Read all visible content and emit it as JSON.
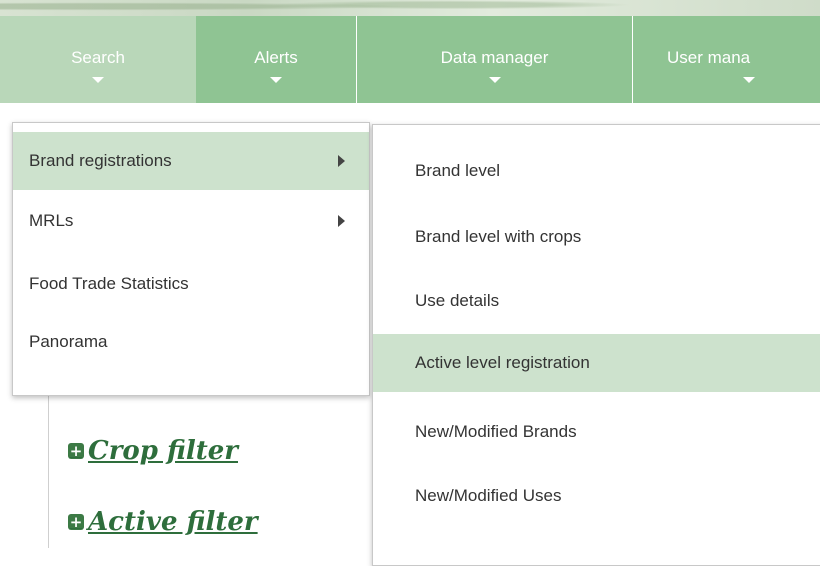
{
  "nav": {
    "items": [
      {
        "label": "Search"
      },
      {
        "label": "Alerts"
      },
      {
        "label": "Data manager"
      },
      {
        "label": "User mana"
      }
    ]
  },
  "search_menu": {
    "items": [
      {
        "label": "Brand registrations",
        "has_submenu": true,
        "highlighted": true
      },
      {
        "label": "MRLs",
        "has_submenu": true
      },
      {
        "label": "Food Trade Statistics"
      },
      {
        "label": "Panorama"
      }
    ]
  },
  "brand_submenu": {
    "items": [
      {
        "label": "Brand level"
      },
      {
        "label": "Brand level with crops"
      },
      {
        "label": "Use details"
      },
      {
        "label": "Active level registration",
        "highlighted": true
      },
      {
        "label": "New/Modified Brands"
      },
      {
        "label": "New/Modified Uses"
      }
    ]
  },
  "filters": {
    "crop": "Crop filter",
    "active": "Active filter"
  },
  "colors": {
    "nav_bg": "#8fc493",
    "nav_active_bg": "#b9d7b9",
    "highlight": "#cde2cd",
    "filter_link": "#2e6e3c"
  }
}
